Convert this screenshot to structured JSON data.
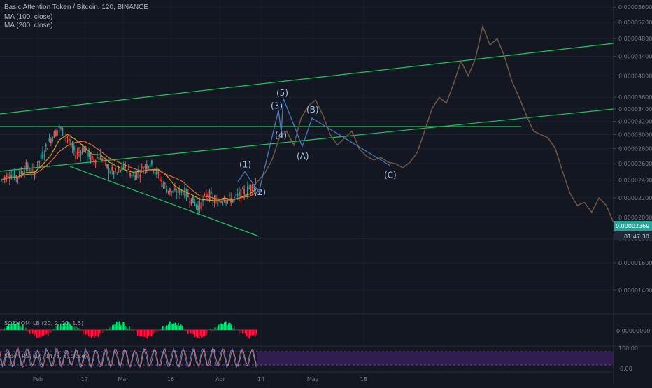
{
  "header": {
    "symbol_line": "Basic Attention Token / Bitcoin, 120, BINANCE",
    "ma100": "MA (100, close)",
    "ma200": "MA (200, close)"
  },
  "indicators": {
    "sqz_label": "SQZMOM_LB (20, 2, 20, 1.5)",
    "sqz_zero": "0.00000000",
    "stoch_label": "Stoch RSI (14, 14, 3, 3, close)",
    "stoch_top": "100.00",
    "stoch_bottom": "0.00"
  },
  "price_tag": {
    "price": "0.00002369",
    "countdown": "01:47:30"
  },
  "colors": {
    "background": "#131722",
    "candle_up": "#26a69a",
    "candle_down": "#ef5350",
    "ma100": "#d4a017",
    "ma200": "#e86a35",
    "projection": "#6d5341",
    "trendline": "#22c55e",
    "wave_line": "#4a7ab8",
    "price_tag": "#26a69a"
  },
  "chart_data": {
    "type": "candlestick",
    "y_axis": {
      "scale": "log",
      "ticks": [
        "0.00005600",
        "0.00005200",
        "0.00004800",
        "0.00004400",
        "0.00004000",
        "0.00003600",
        "0.00003400",
        "0.00003200",
        "0.00003000",
        "0.00002800",
        "0.00002600",
        "0.00002400",
        "0.00002200",
        "0.00002000",
        "0.00001800",
        "0.00001600",
        "0.00001400"
      ],
      "range": [
        1.25e-05,
        5.8e-05
      ]
    },
    "x_axis": {
      "tick_labels": [
        "Feb",
        "17",
        "Mar",
        "16",
        "Apr",
        "14",
        "May",
        "18"
      ]
    },
    "price_series": [
      {
        "t": "Feb",
        "v": 2.4e-05
      },
      {
        "t": "Feb",
        "v": 2.47e-05
      },
      {
        "t": "Feb",
        "v": 2.44e-05
      },
      {
        "t": "Feb",
        "v": 2.56e-05
      },
      {
        "t": "Feb",
        "v": 2.48e-05
      },
      {
        "t": "Feb",
        "v": 2.72e-05
      },
      {
        "t": "Feb",
        "v": 2.94e-05
      },
      {
        "t": "Feb",
        "v": 3.1e-05
      },
      {
        "t": "17",
        "v": 2.96e-05
      },
      {
        "t": "17",
        "v": 2.72e-05
      },
      {
        "t": "17",
        "v": 2.8e-05
      },
      {
        "t": "17",
        "v": 2.65e-05
      },
      {
        "t": "17",
        "v": 2.7e-05
      },
      {
        "t": "17",
        "v": 2.52e-05
      },
      {
        "t": "17",
        "v": 2.48e-05
      },
      {
        "t": "Mar",
        "v": 2.56e-05
      },
      {
        "t": "Mar",
        "v": 2.44e-05
      },
      {
        "t": "Mar",
        "v": 2.52e-05
      },
      {
        "t": "Mar",
        "v": 2.62e-05
      },
      {
        "t": "Mar",
        "v": 2.45e-05
      },
      {
        "t": "Mar",
        "v": 2.3e-05
      },
      {
        "t": "16",
        "v": 2.25e-05
      },
      {
        "t": "16",
        "v": 2.28e-05
      },
      {
        "t": "16",
        "v": 2.18e-05
      },
      {
        "t": "16",
        "v": 2.1e-05
      },
      {
        "t": "16",
        "v": 2.25e-05
      },
      {
        "t": "16",
        "v": 2.15e-05
      },
      {
        "t": "16",
        "v": 2.2e-05
      },
      {
        "t": "Apr",
        "v": 2.18e-05
      },
      {
        "t": "Apr",
        "v": 2.24e-05
      },
      {
        "t": "Apr",
        "v": 2.3e-05
      },
      {
        "t": "Apr",
        "v": 2.38e-05
      }
    ],
    "projection_series": [
      {
        "t": "Apr",
        "v": 2.38e-05
      },
      {
        "t": "Apr",
        "v": 2.48e-05
      },
      {
        "t": "14",
        "v": 2.65e-05
      },
      {
        "t": "14",
        "v": 2.95e-05
      },
      {
        "t": "14",
        "v": 3.05e-05
      },
      {
        "t": "14",
        "v": 2.85e-05
      },
      {
        "t": "14",
        "v": 3.25e-05
      },
      {
        "t": "14",
        "v": 3.45e-05
      },
      {
        "t": "14",
        "v": 3.55e-05
      },
      {
        "t": "14",
        "v": 3.3e-05
      },
      {
        "t": "14",
        "v": 3e-05
      },
      {
        "t": "May",
        "v": 2.85e-05
      },
      {
        "t": "May",
        "v": 2.95e-05
      },
      {
        "t": "May",
        "v": 3.05e-05
      },
      {
        "t": "May",
        "v": 2.8e-05
      },
      {
        "t": "May",
        "v": 2.7e-05
      },
      {
        "t": "May",
        "v": 2.65e-05
      },
      {
        "t": "May",
        "v": 2.68e-05
      },
      {
        "t": "May",
        "v": 2.62e-05
      },
      {
        "t": "May",
        "v": 2.6e-05
      },
      {
        "t": "18",
        "v": 2.55e-05
      },
      {
        "t": "18",
        "v": 2.62e-05
      },
      {
        "t": "18",
        "v": 2.75e-05
      },
      {
        "t": "18",
        "v": 3.05e-05
      },
      {
        "t": "18",
        "v": 3.4e-05
      },
      {
        "t": "18",
        "v": 3.6e-05
      },
      {
        "t": "18",
        "v": 3.5e-05
      },
      {
        "t": "18",
        "v": 3.85e-05
      },
      {
        "t": "18",
        "v": 4.3e-05
      },
      {
        "t": "18",
        "v": 4e-05
      },
      {
        "t": "18",
        "v": 4.35e-05
      },
      {
        "t": "18",
        "v": 5.1e-05
      },
      {
        "t": "18",
        "v": 4.65e-05
      },
      {
        "t": "18",
        "v": 4.8e-05
      },
      {
        "t": "18",
        "v": 4.4e-05
      },
      {
        "t": "18",
        "v": 3.9e-05
      },
      {
        "t": "18",
        "v": 3.6e-05
      },
      {
        "t": "18",
        "v": 3.3e-05
      },
      {
        "t": "18",
        "v": 3.05e-05
      },
      {
        "t": "18",
        "v": 3e-05
      },
      {
        "t": "18",
        "v": 2.95e-05
      },
      {
        "t": "18",
        "v": 2.8e-05
      },
      {
        "t": "18",
        "v": 2.5e-05
      },
      {
        "t": "18",
        "v": 2.25e-05
      },
      {
        "t": "18",
        "v": 2.12e-05
      },
      {
        "t": "18",
        "v": 2.15e-05
      },
      {
        "t": "18",
        "v": 2.05e-05
      },
      {
        "t": "18",
        "v": 2.2e-05
      },
      {
        "t": "18",
        "v": 2.12e-05
      },
      {
        "t": "18",
        "v": 1.95e-05
      }
    ],
    "wave_labels": [
      {
        "label": "(1)",
        "price": 2.5e-05
      },
      {
        "label": "(2)",
        "price": 2.26e-05
      },
      {
        "label": "(3)",
        "price": 3.38e-05
      },
      {
        "label": "(4)",
        "price": 3.03e-05
      },
      {
        "label": "(5)",
        "price": 3.58e-05
      },
      {
        "label": "(A)",
        "price": 2.83e-05
      },
      {
        "label": "(B)",
        "price": 3.25e-05
      },
      {
        "label": "(C)",
        "price": 2.58e-05
      }
    ],
    "horizontal_line": 3.12e-05
  }
}
